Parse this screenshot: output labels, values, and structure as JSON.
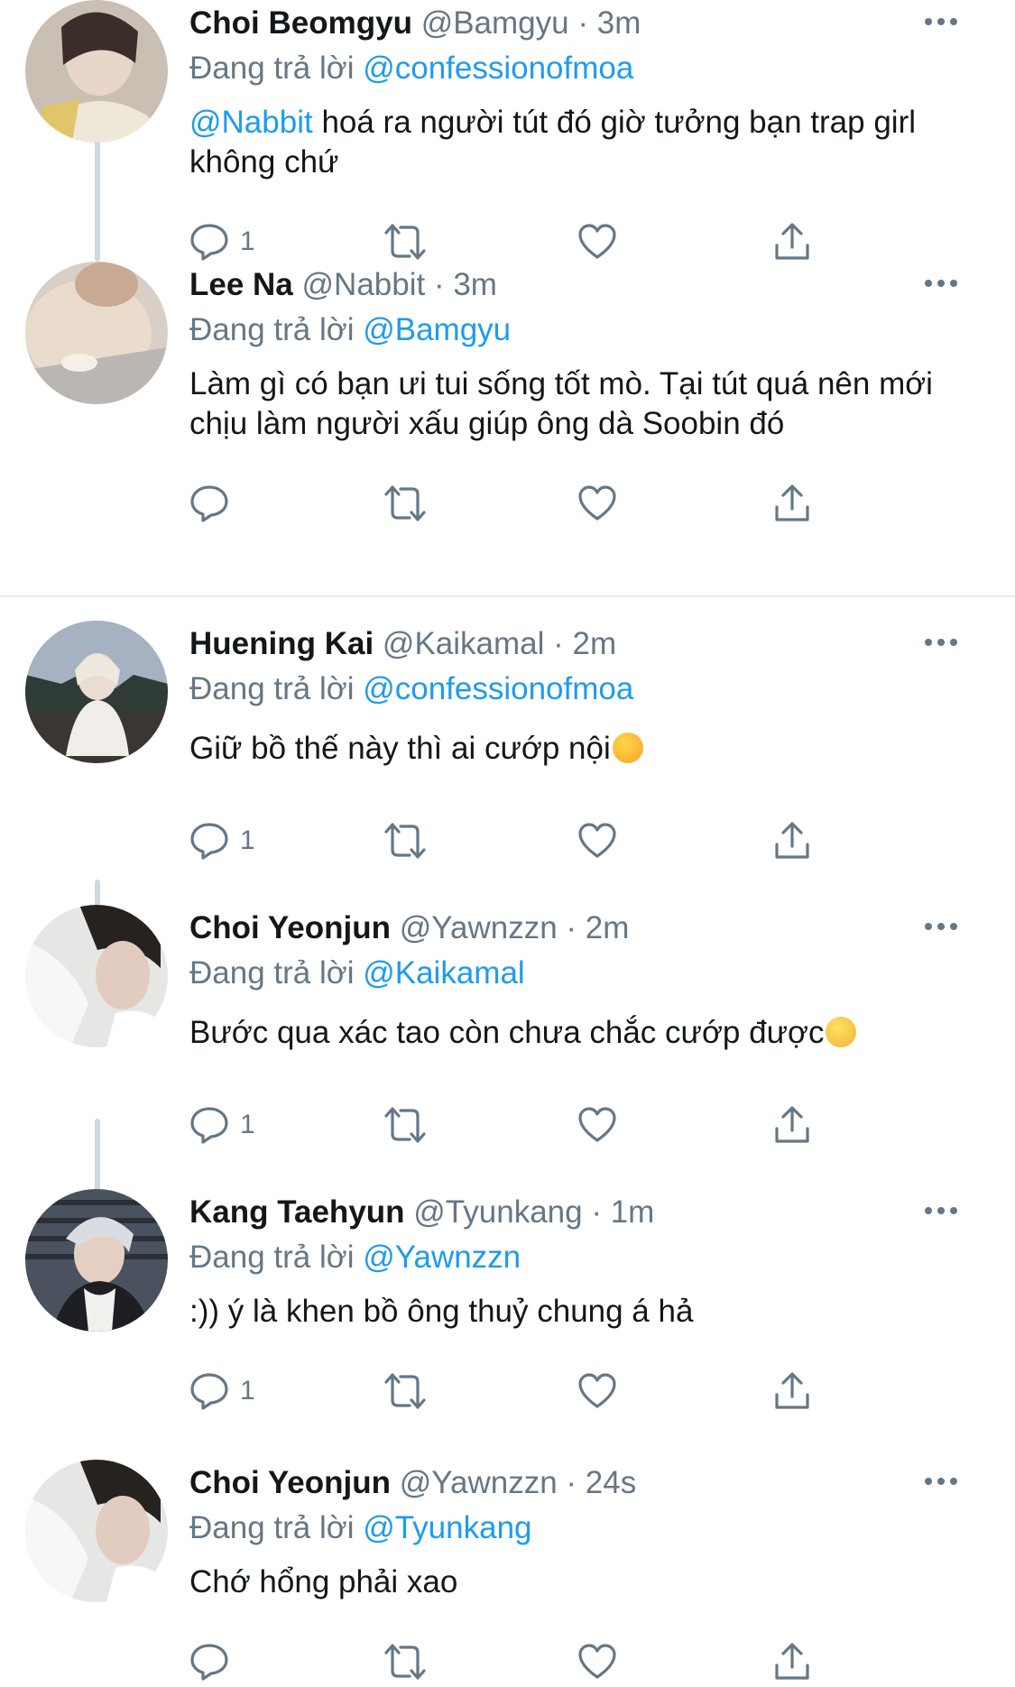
{
  "reply_prefix": "Đang trả lời",
  "tweets": [
    {
      "display_name": "Choi Beomgyu",
      "handle": "@Bamgyu",
      "time": "· 3m",
      "reply_to": "@confessionofmoa",
      "mention": "@Nabbit",
      "text": "hoá ra người tút đó giờ tưởng bạn trap girl không chứ",
      "reply_count": "1",
      "avatar": "photo-pale-face-with-yellow-sleeve"
    },
    {
      "display_name": "Lee Na",
      "handle": "@Nabbit",
      "time": "· 3m",
      "reply_to": "@Bamgyu",
      "text": "Làm gì có bạn ưi tui sống tốt mò. Tại tút quá nên mới chịu làm người xấu giúp ông dà Soobin đó",
      "reply_count": "",
      "avatar": "photo-cream-rabbit"
    },
    {
      "display_name": "Huening Kai",
      "handle": "@Kaikamal",
      "time": "· 2m",
      "reply_to": "@confessionofmoa",
      "text": "Giữ bồ thế này thì ai cướp nội",
      "emoji": "smirking-face-emoji",
      "reply_count": "1",
      "avatar": "photo-person-in-white-sitting-outdoors"
    },
    {
      "display_name": "Choi Yeonjun",
      "handle": "@Yawnzzn",
      "time": "· 2m",
      "reply_to": "@Kaikamal",
      "text": "Bước qua xác tao còn chưa chắc cướp được",
      "emoji": "melting-face-emoji",
      "reply_count": "1",
      "avatar": "photo-man-dark-hair-white-shirt"
    },
    {
      "display_name": "Kang Taehyun",
      "handle": "@Tyunkang",
      "time": "· 1m",
      "reply_to": "@Yawnzzn",
      "text": ":)) ý là khen bồ ông thuỷ chung á hả",
      "reply_count": "1",
      "avatar": "photo-man-silver-hair-dark-jacket"
    },
    {
      "display_name": "Choi Yeonjun",
      "handle": "@Yawnzzn",
      "time": "· 24s",
      "reply_to": "@Tyunkang",
      "text": "Chớ hổng phải xao",
      "reply_count": "",
      "avatar": "photo-man-dark-hair-white-shirt"
    }
  ],
  "colors": {
    "link": "#1d9bf0",
    "muted": "#657786",
    "text": "#14171a",
    "thread_line": "#cfd9de"
  }
}
